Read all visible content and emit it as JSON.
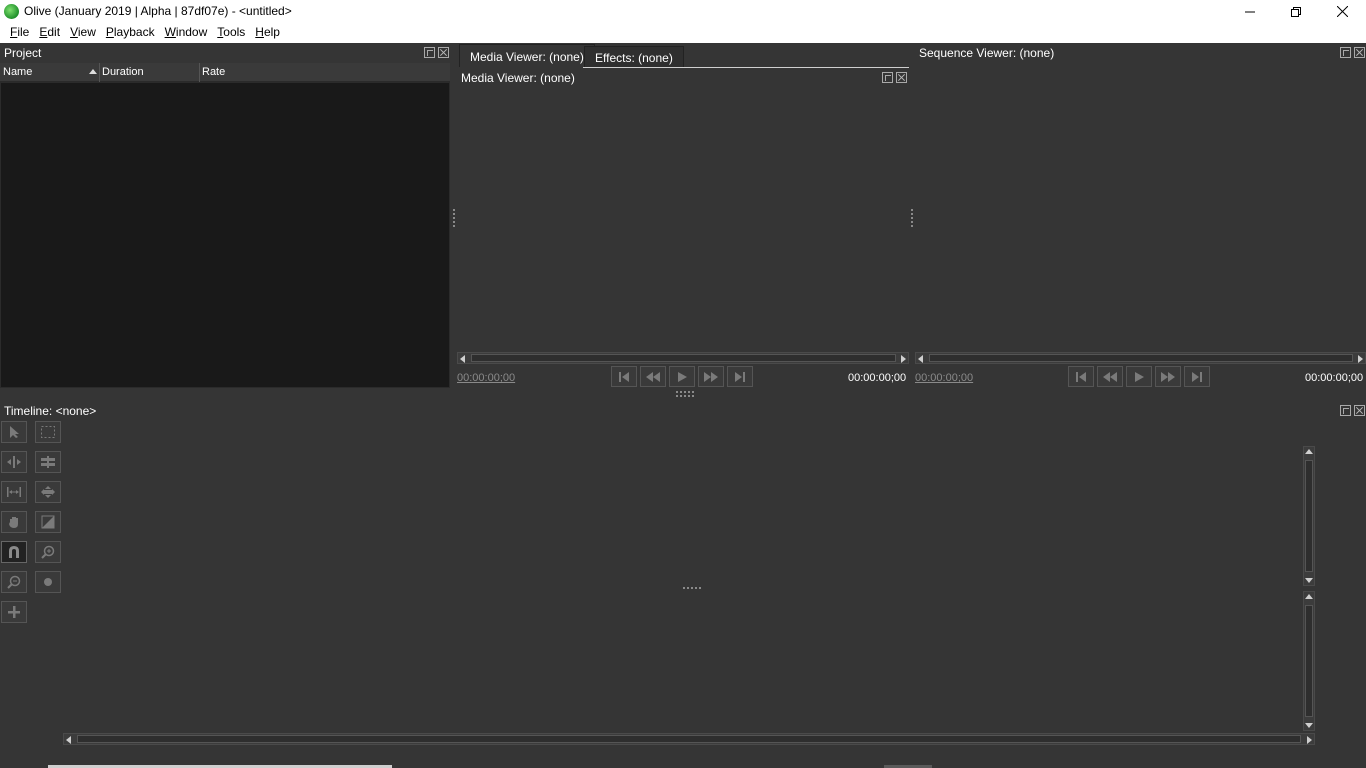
{
  "window": {
    "title": "Olive (January 2019 | Alpha | 87df07e) - <untitled>",
    "app_icon": "olive-logo-icon",
    "controls": [
      "minimize-icon",
      "restore-icon",
      "close-icon"
    ]
  },
  "menubar": {
    "items": [
      {
        "label": "File",
        "mnemonic": "F"
      },
      {
        "label": "Edit",
        "mnemonic": "E"
      },
      {
        "label": "View",
        "mnemonic": "V"
      },
      {
        "label": "Playback",
        "mnemonic": "P"
      },
      {
        "label": "Window",
        "mnemonic": "W"
      },
      {
        "label": "Tools",
        "mnemonic": "T"
      },
      {
        "label": "Help",
        "mnemonic": "H"
      }
    ]
  },
  "project": {
    "title": "Project",
    "columns": [
      "Name",
      "Duration",
      "Rate"
    ],
    "sort_column": "Name"
  },
  "media_viewer": {
    "tabs": [
      {
        "label": "Media Viewer: (none)",
        "active": true
      },
      {
        "label": "Effects: (none)",
        "active": false
      }
    ],
    "title": "Media Viewer: (none)",
    "timecode_left": "00:00:00;00",
    "timecode_right": "00:00:00;00"
  },
  "sequence_viewer": {
    "title": "Sequence Viewer: (none)",
    "timecode_left": "00:00:00;00",
    "timecode_right": "00:00:00;00"
  },
  "playback_buttons": [
    "go-to-start-icon",
    "rewind-icon",
    "play-icon",
    "fast-forward-icon",
    "go-to-end-icon"
  ],
  "timeline": {
    "title": "Timeline: <none>",
    "tools": [
      "pointer-tool-icon",
      "edit-tool-icon",
      "ripple-tool-icon",
      "razor-tool-icon",
      "slip-tool-icon",
      "slide-tool-icon",
      "hand-tool-icon",
      "transition-tool-icon",
      "snapping-icon",
      "zoom-in-icon",
      "zoom-out-icon",
      "record-icon",
      "add-icon"
    ]
  },
  "colors": {
    "background": "#353535",
    "project_list_bg": "#191919",
    "menubar_bg": "#ffffff"
  }
}
